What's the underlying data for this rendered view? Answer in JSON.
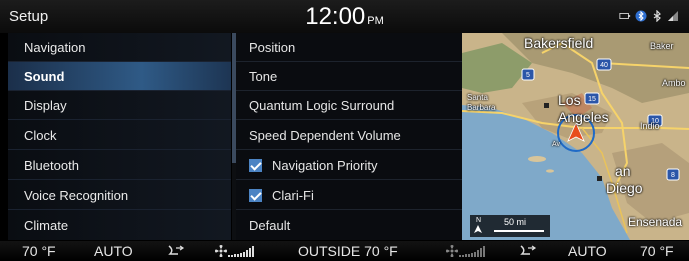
{
  "status": {
    "title": "Setup",
    "time": "12:00",
    "ampm": "PM"
  },
  "menu": {
    "items": [
      {
        "label": "Navigation"
      },
      {
        "label": "Sound",
        "active": true
      },
      {
        "label": "Display"
      },
      {
        "label": "Clock"
      },
      {
        "label": "Bluetooth"
      },
      {
        "label": "Voice Recognition"
      },
      {
        "label": "Climate"
      }
    ]
  },
  "sound": {
    "items": [
      {
        "label": "Position"
      },
      {
        "label": "Tone"
      },
      {
        "label": "Quantum Logic Surround"
      },
      {
        "label": "Speed Dependent Volume"
      },
      {
        "label": "Navigation Priority",
        "checked": true
      },
      {
        "label": "Clari-Fi",
        "checked": true
      },
      {
        "label": "Default"
      }
    ]
  },
  "map": {
    "labels": {
      "bakersfield": "Bakersfield",
      "baker": "Baker",
      "los1": "Los",
      "los2": "Angeles",
      "santa": "Santa",
      "barbara": "Barbara",
      "indio": "Indio",
      "an": "an",
      "diego": "Diego",
      "ensenada": "Ensenada",
      "avalon": "Av",
      "amboy": "Ambo"
    },
    "shields": [
      "40",
      "5",
      "15",
      "8",
      "10"
    ],
    "scale": {
      "north": "N",
      "distance": "50 mi"
    }
  },
  "climate": {
    "left_temp": "70 °F",
    "left_mode": "AUTO",
    "outside": "OUTSIDE  70 °F",
    "right_mode": "AUTO",
    "right_temp": "70 °F",
    "fan_level_fraction": 1.0
  },
  "colors": {
    "accent": "#2f5a86",
    "checkbox": "#4c84c4"
  }
}
